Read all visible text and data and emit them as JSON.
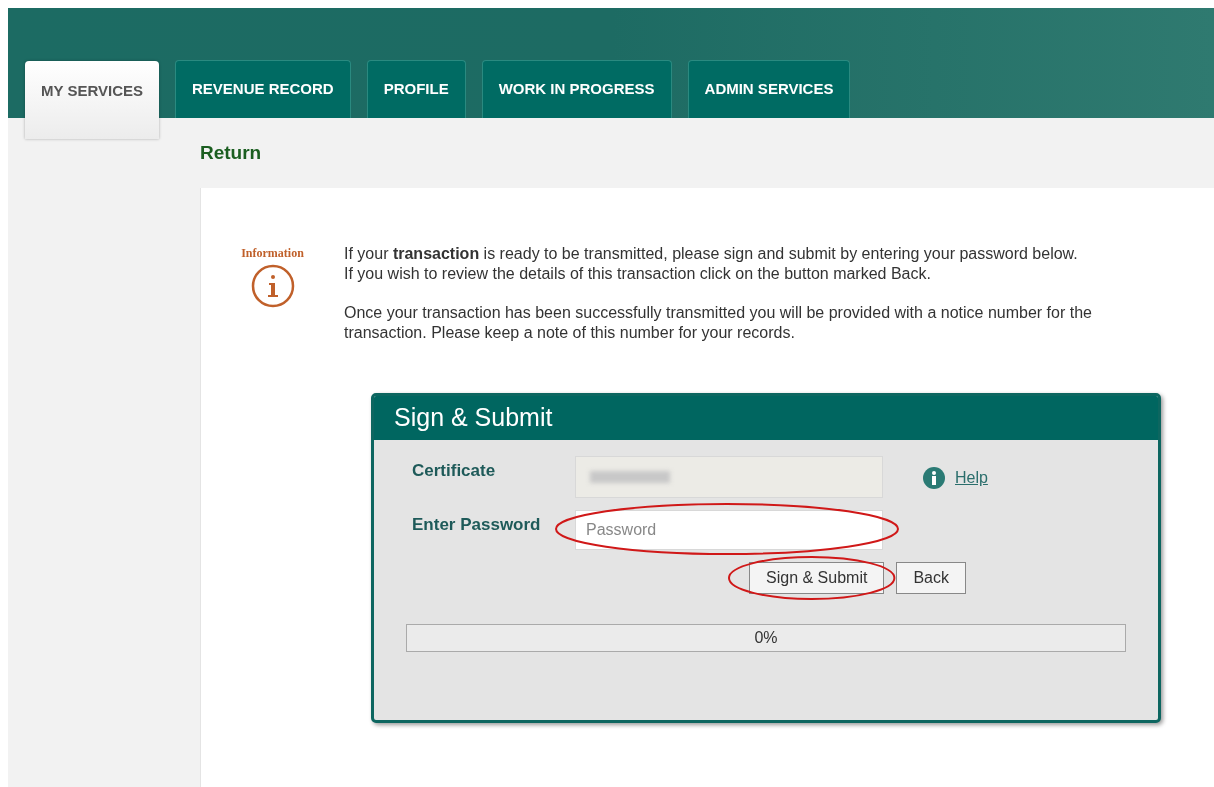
{
  "tabs": [
    {
      "label": "MY SERVICES",
      "selected": true
    },
    {
      "label": "REVENUE RECORD",
      "selected": false
    },
    {
      "label": "PROFILE",
      "selected": false
    },
    {
      "label": "WORK IN PROGRESS",
      "selected": false
    },
    {
      "label": "ADMIN SERVICES",
      "selected": false
    }
  ],
  "page_title": "Return",
  "information": {
    "label": "Information",
    "paragraphs": [
      "If your **transaction** is ready to be transmitted, please sign and submit by entering your password below.\nIf you wish to review the details of this transaction click on the button marked Back.",
      "Once your transaction has been successfully transmitted you will be provided with a notice number for the transaction. Please keep a note of this number for your records."
    ]
  },
  "sign_submit": {
    "title": "Sign & Submit",
    "certificate_label": "Certificate",
    "help_link": "Help",
    "password_label": "Enter Password",
    "password": {
      "placeholder": "Password",
      "highlighted": true
    },
    "buttons": [
      {
        "label": "Sign & Submit",
        "highlighted": true
      },
      {
        "label": "Back",
        "highlighted": false
      }
    ],
    "progress": {
      "level": 0,
      "reading": "0%"
    }
  }
}
